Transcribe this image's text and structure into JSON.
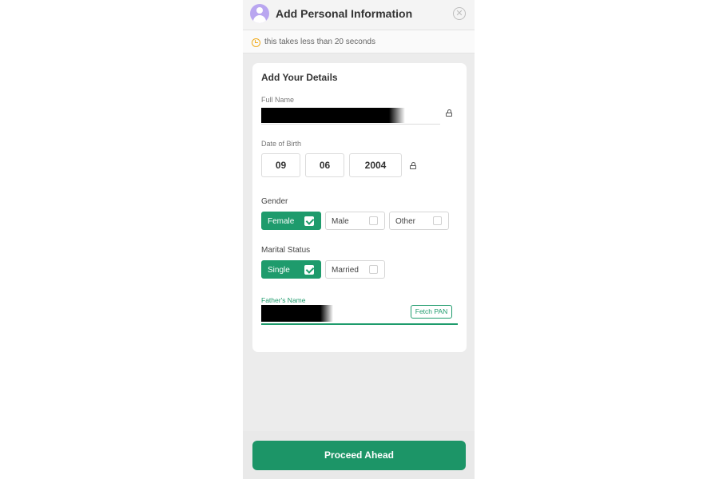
{
  "header": {
    "title": "Add Personal Information",
    "close_icon": "close-icon"
  },
  "timer": {
    "text": "this takes less than 20 seconds",
    "icon": "clock-icon",
    "icon_color": "#f0ab1b"
  },
  "form": {
    "title": "Add Your Details",
    "full_name": {
      "label": "Full Name",
      "value_redacted": true,
      "locked": true
    },
    "dob": {
      "label": "Date of Birth",
      "day": "09",
      "month": "06",
      "year": "2004",
      "locked": true
    },
    "gender": {
      "label": "Gender",
      "options": [
        {
          "label": "Female",
          "checked": true
        },
        {
          "label": "Male",
          "checked": false
        },
        {
          "label": "Other",
          "checked": false
        }
      ]
    },
    "marital_status": {
      "label": "Marital Status",
      "options": [
        {
          "label": "Single",
          "checked": true
        },
        {
          "label": "Married",
          "checked": false
        }
      ]
    },
    "father_name": {
      "label": "Father's Name",
      "value_redacted": true,
      "fetch_label": "Fetch PAN"
    }
  },
  "footer": {
    "proceed_label": "Proceed Ahead"
  },
  "colors": {
    "accent": "#1e9b6c",
    "background": "#ececec",
    "card": "#ffffff"
  }
}
